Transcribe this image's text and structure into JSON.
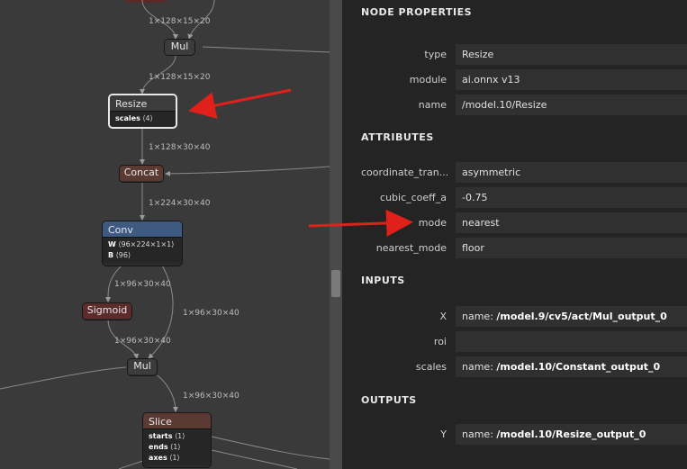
{
  "graph": {
    "edge_labels": {
      "top": "1×128×15×20",
      "mul_out": "1×128×15×20",
      "resize_out": "1×128×30×40",
      "concat_out": "1×224×30×40",
      "conv_left": "1×96×30×40",
      "conv_right": "1×96×30×40",
      "sigmoid_out": "1×96×30×40",
      "mul2_out": "1×96×30×40"
    },
    "nodes": {
      "mul1": {
        "title": "Mul"
      },
      "resize": {
        "title": "Resize",
        "attrs": [
          {
            "k": "scales",
            "v": "⟨4⟩"
          }
        ]
      },
      "concat": {
        "title": "Concat"
      },
      "conv": {
        "title": "Conv",
        "attrs": [
          {
            "k": "W",
            "v": "⟨96×224×1×1⟩"
          },
          {
            "k": "B",
            "v": "⟨96⟩"
          }
        ]
      },
      "sigmoid": {
        "title": "Sigmoid"
      },
      "mul2": {
        "title": "Mul"
      },
      "slice": {
        "title": "Slice",
        "attrs": [
          {
            "k": "starts",
            "v": "⟨1⟩"
          },
          {
            "k": "ends",
            "v": "⟨1⟩"
          },
          {
            "k": "axes",
            "v": "⟨1⟩"
          }
        ]
      }
    }
  },
  "panel": {
    "title": "NODE PROPERTIES",
    "props": [
      {
        "key": "type",
        "value": "Resize"
      },
      {
        "key": "module",
        "value": "ai.onnx v13"
      },
      {
        "key": "name",
        "value": "/model.10/Resize"
      }
    ],
    "attributes_title": "ATTRIBUTES",
    "attributes": [
      {
        "key": "coordinate_tran...",
        "value": "asymmetric"
      },
      {
        "key": "cubic_coeff_a",
        "value": "-0.75"
      },
      {
        "key": "mode",
        "value": "nearest"
      },
      {
        "key": "nearest_mode",
        "value": "floor"
      }
    ],
    "inputs_title": "INPUTS",
    "inputs": [
      {
        "key": "X",
        "prefix": "name: ",
        "value": "/model.9/cv5/act/Mul_output_0"
      },
      {
        "key": "roi",
        "prefix": "",
        "value": ""
      },
      {
        "key": "scales",
        "prefix": "name: ",
        "value": "/model.10/Constant_output_0"
      }
    ],
    "outputs_title": "OUTPUTS",
    "outputs": [
      {
        "key": "Y",
        "prefix": "name: ",
        "value": "/model.10/Resize_output_0"
      }
    ]
  },
  "colors": {
    "canvas": "#3a3a3a",
    "panel": "#242424",
    "conv_header": "#3f5a80",
    "sigmoid_header": "#5c2b2b",
    "concat_header": "#5a3a33",
    "annotation_arrow": "#e0201a"
  }
}
